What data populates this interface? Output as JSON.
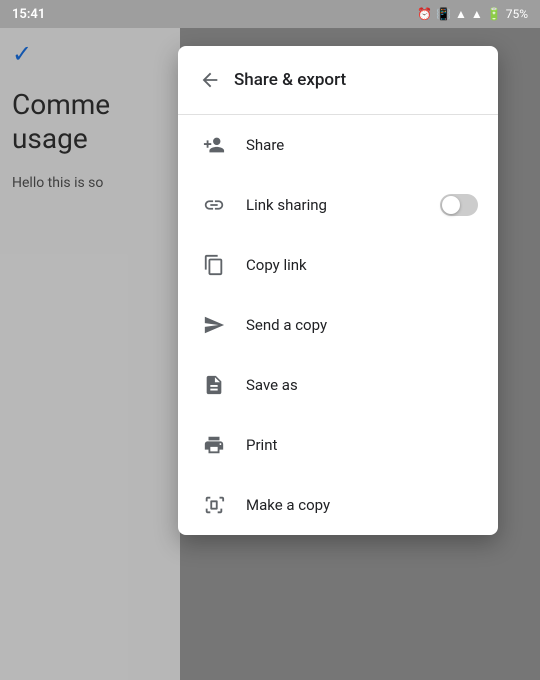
{
  "statusBar": {
    "time": "15:41",
    "battery": "75%"
  },
  "background": {
    "checkmark": "✓",
    "title": "Comme\nusage",
    "bodyText": "Hello this is so"
  },
  "drawer": {
    "headerTitle": "Share & export",
    "backIconLabel": "back-arrow",
    "menuItems": [
      {
        "id": "share",
        "label": "Share",
        "icon": "share-person-icon",
        "hasToggle": false
      },
      {
        "id": "link-sharing",
        "label": "Link sharing",
        "icon": "link-icon",
        "hasToggle": true,
        "toggleOn": false
      },
      {
        "id": "copy-link",
        "label": "Copy link",
        "icon": "copy-icon",
        "hasToggle": false
      },
      {
        "id": "send-copy",
        "label": "Send a copy",
        "icon": "send-icon",
        "hasToggle": false
      },
      {
        "id": "save-as",
        "label": "Save as",
        "icon": "save-as-icon",
        "hasToggle": false
      },
      {
        "id": "print",
        "label": "Print",
        "icon": "print-icon",
        "hasToggle": false
      },
      {
        "id": "make-copy",
        "label": "Make a copy",
        "icon": "make-copy-icon",
        "hasToggle": false
      }
    ]
  }
}
